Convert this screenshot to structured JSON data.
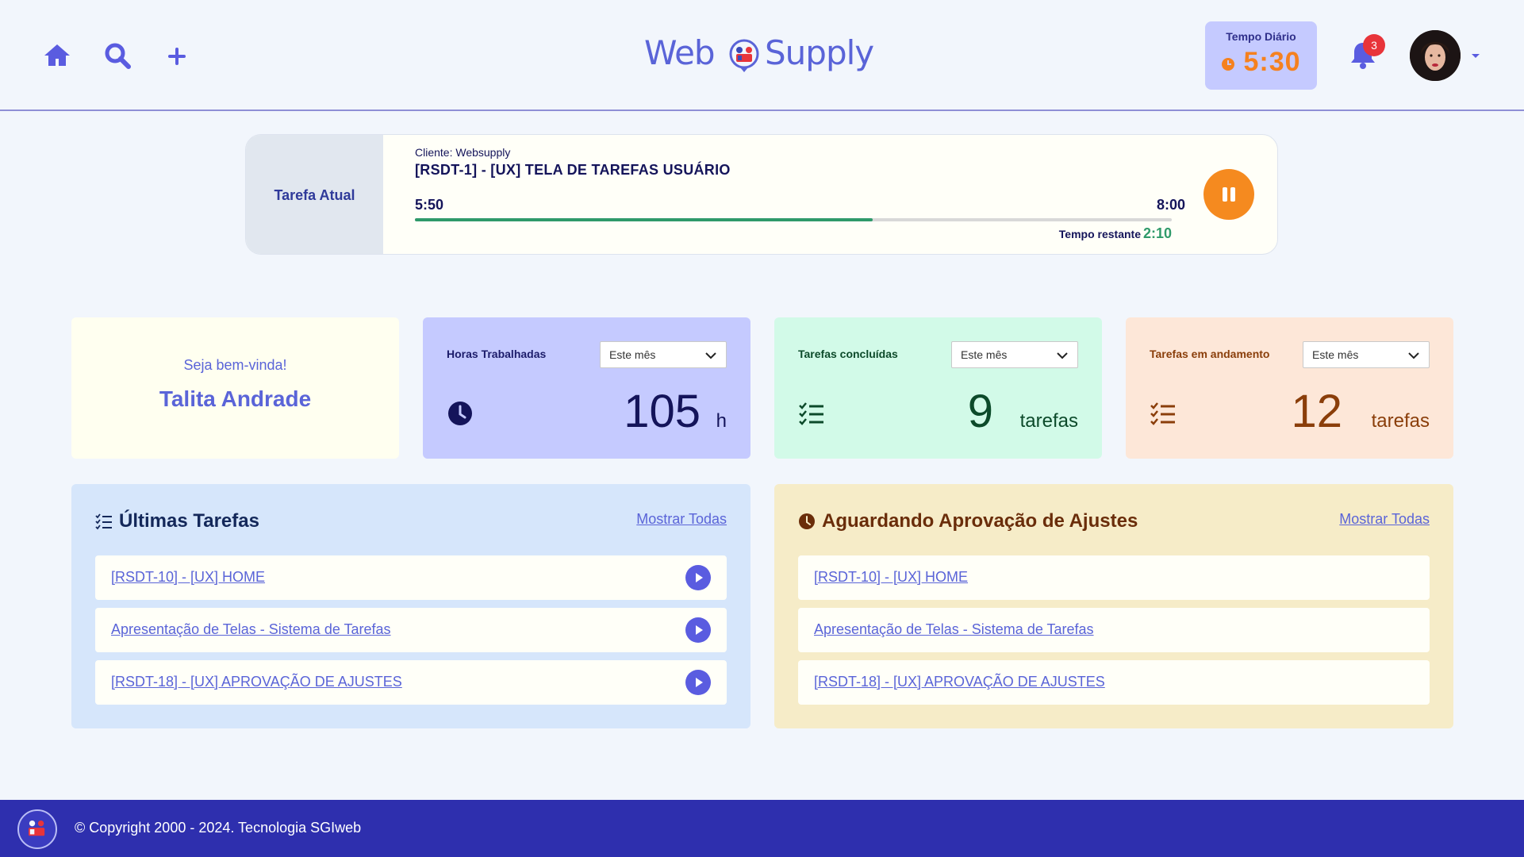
{
  "header": {
    "logo_text_left": "Web",
    "logo_text_right": "Supply",
    "tempo_label": "Tempo Diário",
    "tempo_value": "5:30",
    "notifications_count": "3"
  },
  "current_task": {
    "side_label": "Tarefa Atual",
    "client": "Cliente: Websupply",
    "title": "[RSDT-1] - [UX] TELA DE TAREFAS USUÁRIO",
    "start": "5:50",
    "end": "8:00",
    "progress_fraction": 0.605,
    "remaining_label": "Tempo restante",
    "remaining_value": "2:10"
  },
  "welcome": {
    "greeting": "Seja bem-vinda!",
    "name": "Talita Andrade"
  },
  "stats": {
    "horas": {
      "label": "Horas Trabalhadas",
      "filter": "Este mês",
      "value": "105",
      "unit": "h"
    },
    "concluidas": {
      "label": "Tarefas concluídas",
      "filter": "Este mês",
      "value": "9",
      "unit": "tarefas"
    },
    "andamento": {
      "label": "Tarefas em andamento",
      "filter": "Este mês",
      "value": "12",
      "unit": "tarefas"
    }
  },
  "ultimas": {
    "title": "Últimas Tarefas",
    "show_all": "Mostrar Todas",
    "items": [
      {
        "label": "[RSDT-10] - [UX] HOME "
      },
      {
        "label": "Apresentação de Telas - Sistema de Tarefas"
      },
      {
        "label": "[RSDT-18] - [UX] APROVAÇÃO DE AJUSTES"
      }
    ]
  },
  "aprovacao": {
    "title": "Aguardando Aprovação de Ajustes",
    "show_all": "Mostrar Todas",
    "items": [
      {
        "label": "[RSDT-10] - [UX] HOME "
      },
      {
        "label": "Apresentação de Telas - Sistema de Tarefas"
      },
      {
        "label": "[RSDT-18] - [UX] APROVAÇÃO DE AJUSTES"
      }
    ]
  },
  "footer": {
    "copyright": "© Copyright 2000 - 2024. Tecnologia SGIweb"
  },
  "colors": {
    "accent": "#5a64d8",
    "orange": "#f58a1f",
    "green": "#2f9a6a",
    "footer_bg": "#2e2fae"
  }
}
